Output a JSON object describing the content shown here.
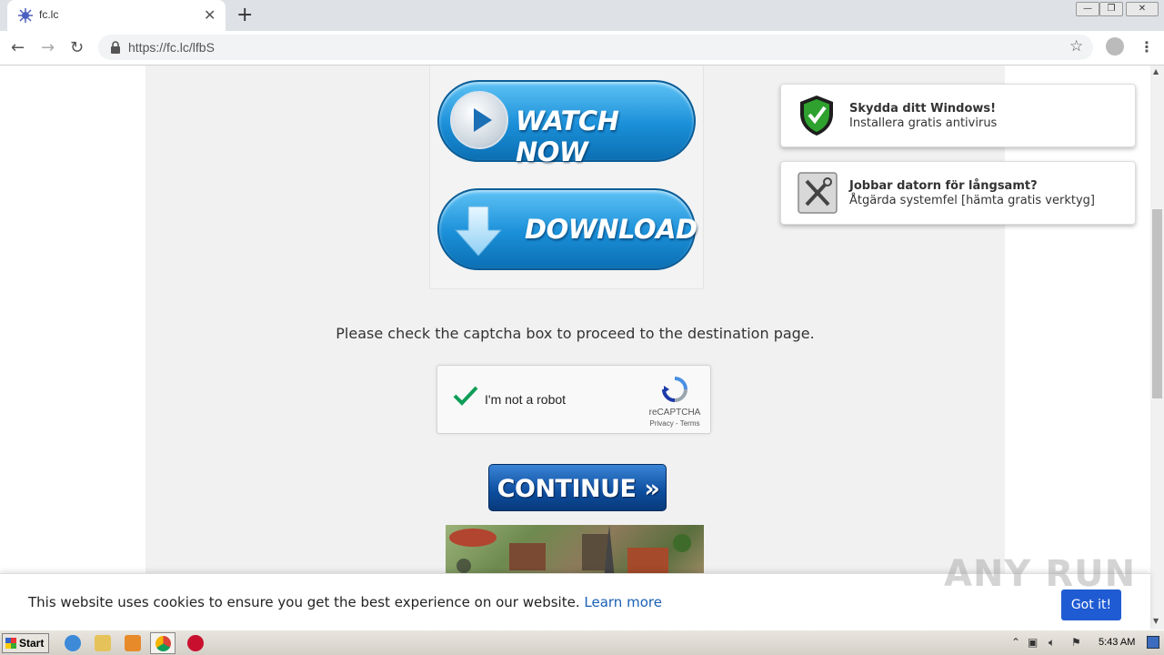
{
  "browser": {
    "tab_title": "fc.lc",
    "url": "https://fc.lc/lfbS",
    "new_tab": "+",
    "tab_close": "✕"
  },
  "page": {
    "watch_label": "WATCH NOW",
    "download_label": "DOWNLOAD",
    "captcha_message": "Please check the captcha box to proceed to the destination page.",
    "recaptcha": {
      "label": "I'm not a robot",
      "brand": "reCAPTCHA",
      "links": "Privacy - Terms",
      "checked": true
    },
    "continue_label": "CONTINUE »"
  },
  "widgets": [
    {
      "title": "Skydda ditt Windows!",
      "subtitle": "Installera gratis antivirus",
      "icon": "shield-check-icon"
    },
    {
      "title": "Jobbar datorn för långsamt?",
      "subtitle": "Åtgärda systemfel [hämta gratis verktyg]",
      "icon": "tools-icon"
    }
  ],
  "cookie_bar": {
    "text": "This website uses cookies to ensure you get the best experience on our website.",
    "link": "Learn more",
    "button": "Got it!"
  },
  "watermark": "ANY RUN",
  "taskbar": {
    "start": "Start",
    "clock": "5:43 AM"
  },
  "colors": {
    "accent_blue": "#1f5bd3",
    "content_bg": "#f1f1f1",
    "shield_green": "#2ea12e"
  }
}
